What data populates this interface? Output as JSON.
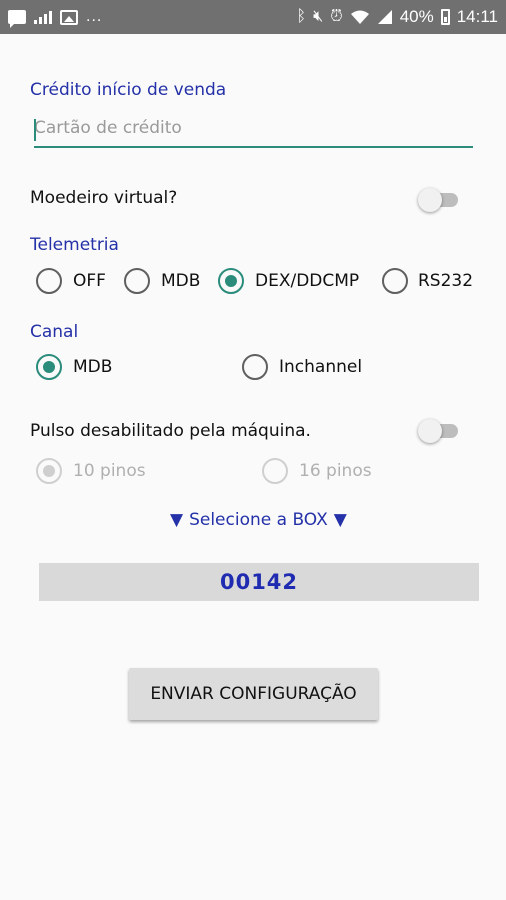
{
  "status_bar": {
    "dots": "...",
    "battery": "40%",
    "time": "14:11",
    "icons": [
      "chat-icon",
      "signal-bars-icon",
      "image-icon",
      "bluetooth-icon",
      "mute-icon",
      "alarm-icon",
      "wifi-icon",
      "cell-signal-icon",
      "battery-icon"
    ]
  },
  "credit": {
    "label": "Crédito início de venda",
    "placeholder": "Cartão de crédito"
  },
  "virtual_coin": {
    "label": "Moedeiro virtual?",
    "checked": false
  },
  "telemetry": {
    "label": "Telemetria",
    "options": [
      {
        "label": "OFF",
        "selected": false
      },
      {
        "label": "MDB",
        "selected": false
      },
      {
        "label": "DEX/DDCMP",
        "selected": true
      },
      {
        "label": "RS232",
        "selected": false
      }
    ]
  },
  "channel": {
    "label": "Canal",
    "options": [
      {
        "label": "MDB",
        "selected": true
      },
      {
        "label": "Inchannel",
        "selected": false
      }
    ]
  },
  "pulse": {
    "label": "Pulso desabilitado pela máquina.",
    "checked": false,
    "options": [
      {
        "label": "10 pinos",
        "selected": true
      },
      {
        "label": "16 pinos",
        "selected": false
      }
    ]
  },
  "box": {
    "select_label": "Selecione a BOX",
    "value": "00142"
  },
  "send_button": "ENVIAR CONFIGURAÇÃO",
  "colors": {
    "accent": "#2b8c7b",
    "label_blue": "#2431a8",
    "status_bar": "#707070"
  }
}
